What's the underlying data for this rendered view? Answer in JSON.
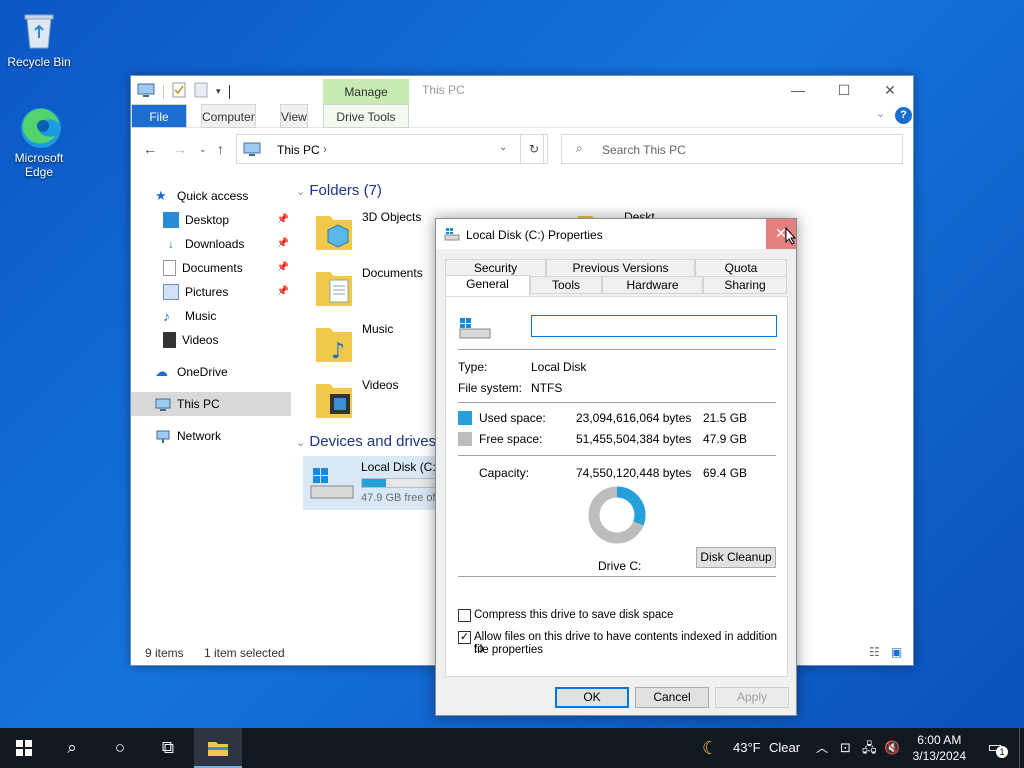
{
  "desktop": {
    "icons": [
      {
        "label": "Recycle Bin"
      },
      {
        "label": "Microsoft Edge"
      }
    ]
  },
  "explorer": {
    "ribbon": {
      "manage": "Manage",
      "file": "File",
      "computer": "Computer",
      "view": "View",
      "drive_tools": "Drive Tools"
    },
    "title": "This PC",
    "address": "This PC",
    "search_placeholder": "Search This PC",
    "nav": {
      "quick_access": "Quick access",
      "desktop": "Desktop",
      "downloads": "Downloads",
      "documents": "Documents",
      "pictures": "Pictures",
      "music": "Music",
      "videos": "Videos",
      "onedrive": "OneDrive",
      "this_pc": "This PC",
      "network": "Network"
    },
    "folders_heading": "Folders (7)",
    "folders": [
      "3D Objects",
      "Documents",
      "Music",
      "Videos"
    ],
    "folder_partial": "Deskt",
    "devices_heading": "Devices and drives",
    "drive": {
      "name": "Local Disk (C:)",
      "free_text": "47.9 GB free of",
      "used_fraction": 0.31
    },
    "status": {
      "items": "9 items",
      "selected": "1 item selected"
    }
  },
  "dialog": {
    "title": "Local Disk (C:) Properties",
    "tabs_row1": [
      "Security",
      "Previous Versions",
      "Quota"
    ],
    "tabs_row2": [
      "General",
      "Tools",
      "Hardware",
      "Sharing"
    ],
    "active_tab": "General",
    "name_value": "",
    "type_label": "Type:",
    "type_value": "Local Disk",
    "fs_label": "File system:",
    "fs_value": "NTFS",
    "used_label": "Used space:",
    "used_bytes": "23,094,616,064 bytes",
    "used_gb": "21.5 GB",
    "free_label": "Free space:",
    "free_bytes": "51,455,504,384 bytes",
    "free_gb": "47.9 GB",
    "capacity_label": "Capacity:",
    "capacity_bytes": "74,550,120,448 bytes",
    "capacity_gb": "69.4 GB",
    "drive_label": "Drive C:",
    "disk_cleanup": "Disk Cleanup",
    "compress_label": "Compress this drive to save disk space",
    "compress_checked": false,
    "index_label_1": "Allow files on this drive to have contents indexed in addition to",
    "index_label_2": "file properties",
    "index_checked": true,
    "ok": "OK",
    "cancel": "Cancel",
    "apply": "Apply",
    "used_color": "#26a0da",
    "free_color": "#bdbdbd"
  },
  "taskbar": {
    "weather_temp": "43°F",
    "weather_cond": "Clear",
    "time": "6:00 AM",
    "date": "3/13/2024",
    "notif_count": "1"
  }
}
